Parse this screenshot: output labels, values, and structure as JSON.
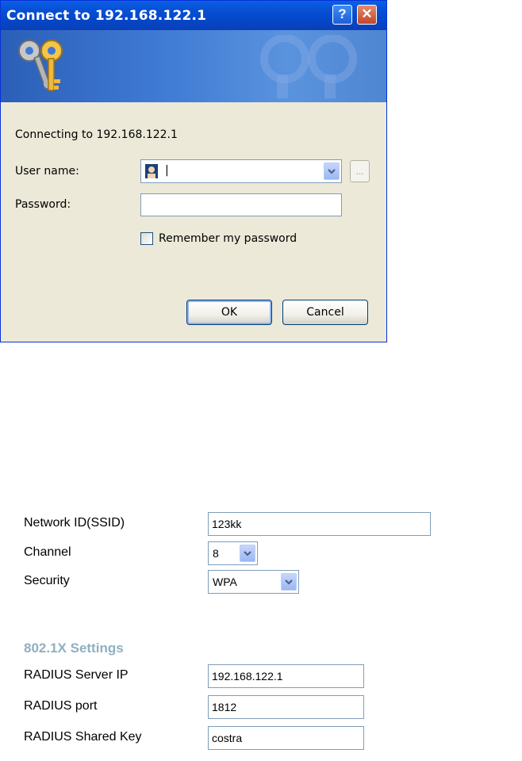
{
  "dialog": {
    "title": "Connect to 192.168.122.1",
    "help_glyph": "?",
    "close_glyph": "✕",
    "connecting_text": "Connecting to 192.168.122.1",
    "user_label": "User name:",
    "user_value": "|",
    "password_label": "Password:",
    "browse_label": "...",
    "remember_label": "Remember my password",
    "ok_label": "OK",
    "cancel_label": "Cancel"
  },
  "form": {
    "ssid_label": "Network ID(SSID)",
    "ssid_value": "123kk",
    "channel_label": "Channel",
    "channel_value": "8",
    "security_label": "Security",
    "security_value": "WPA",
    "section_heading": "802.1X Settings",
    "radius_ip_label": "RADIUS Server IP",
    "radius_ip_value": "192.168.122.1",
    "radius_port_label": "RADIUS port",
    "radius_port_value": "1812",
    "radius_key_label": "RADIUS Shared Key",
    "radius_key_value": "costra"
  },
  "colors": {
    "titlebar": "#0a5fe6",
    "dialog_bg": "#ece9d8",
    "section_heading": "#8fb0c0"
  },
  "icons": [
    "keys-icon",
    "help-icon",
    "close-icon",
    "user-avatar-icon",
    "chevron-down-icon",
    "checkbox"
  ]
}
